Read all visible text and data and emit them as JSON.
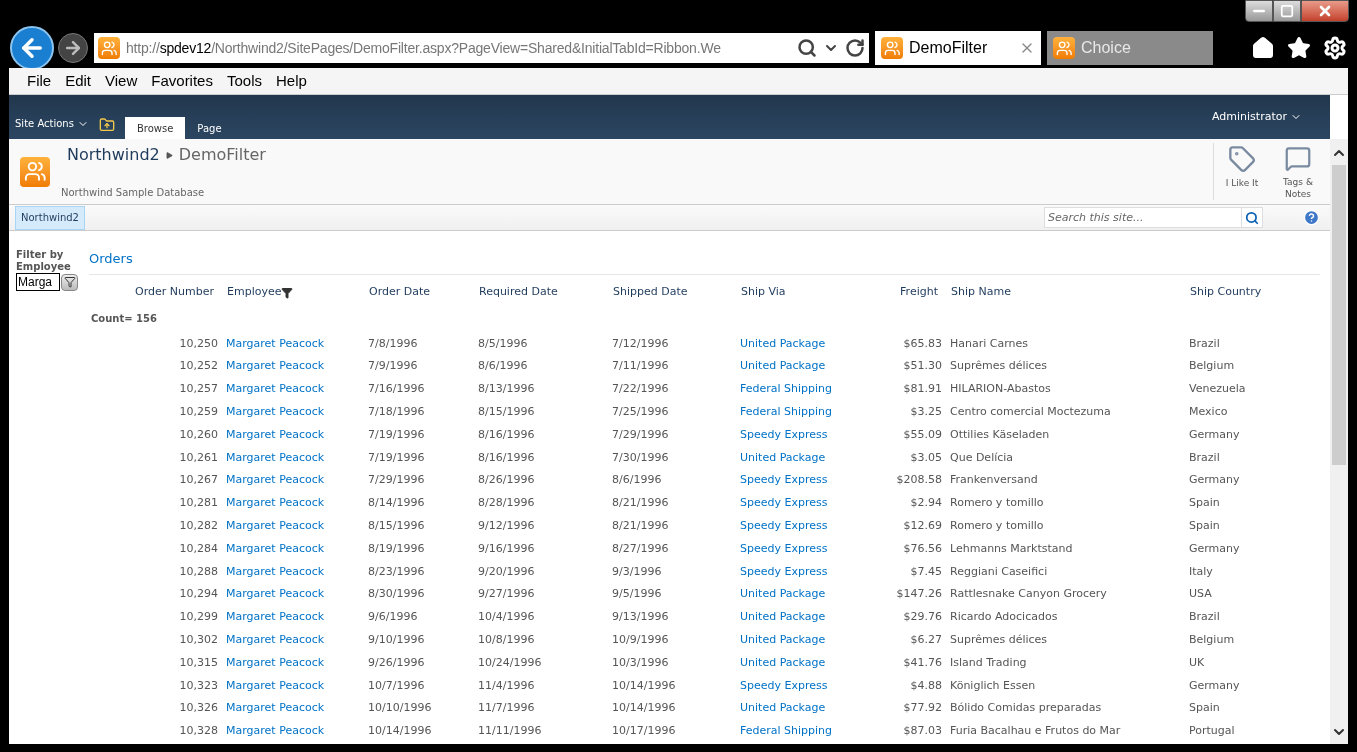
{
  "browser": {
    "url": [
      {
        "text": "http://",
        "emphasis": false
      },
      {
        "text": "spdev12",
        "emphasis": true
      },
      {
        "text": "/Northwind2/SitePages/DemoFilter.aspx?PageView=Shared&InitialTabId=Ribbon.We",
        "emphasis": false
      }
    ],
    "tabs": [
      {
        "title": "DemoFilter",
        "selected": true
      },
      {
        "title": "Choice",
        "selected": false
      }
    ],
    "menu": [
      "File",
      "Edit",
      "View",
      "Favorites",
      "Tools",
      "Help"
    ]
  },
  "ribbon": {
    "site_actions": "Site Actions",
    "tabs": [
      {
        "label": "Browse",
        "selected": true
      },
      {
        "label": "Page",
        "selected": false
      }
    ],
    "user": "Administrator"
  },
  "header": {
    "breadcrumb": [
      "Northwind2",
      "DemoFilter"
    ],
    "description": "Northwind Sample Database",
    "actions": [
      {
        "kind": "like",
        "label": "I Like It"
      },
      {
        "kind": "tags",
        "label": "Tags & Notes"
      }
    ]
  },
  "nav": {
    "items": [
      {
        "label": "Northwind2",
        "selected": true
      }
    ],
    "search_placeholder": "Search this site..."
  },
  "filter": {
    "label": "Filter by Employee",
    "value": "Marga"
  },
  "orders": {
    "title": "Orders",
    "count": "Count= 156",
    "columns": [
      {
        "label": "Order Number",
        "kind": "number",
        "filtered": false
      },
      {
        "label": "Employee",
        "kind": "link",
        "filtered": true
      },
      {
        "label": "Order Date",
        "kind": "text",
        "filtered": false
      },
      {
        "label": "Required Date",
        "kind": "text",
        "filtered": false
      },
      {
        "label": "Shipped Date",
        "kind": "text",
        "filtered": false
      },
      {
        "label": "Ship Via",
        "kind": "link",
        "filtered": false
      },
      {
        "label": "Freight",
        "kind": "number",
        "filtered": false
      },
      {
        "label": "Ship Name",
        "kind": "text",
        "filtered": false
      },
      {
        "label": "Ship Country",
        "kind": "text",
        "filtered": false
      }
    ],
    "rows": [
      [
        "10,250",
        "Margaret Peacock",
        "7/8/1996",
        "8/5/1996",
        "7/12/1996",
        "United Package",
        "$65.83",
        "Hanari Carnes",
        "Brazil"
      ],
      [
        "10,252",
        "Margaret Peacock",
        "7/9/1996",
        "8/6/1996",
        "7/11/1996",
        "United Package",
        "$51.30",
        "Suprêmes délices",
        "Belgium"
      ],
      [
        "10,257",
        "Margaret Peacock",
        "7/16/1996",
        "8/13/1996",
        "7/22/1996",
        "Federal Shipping",
        "$81.91",
        "HILARION-Abastos",
        "Venezuela"
      ],
      [
        "10,259",
        "Margaret Peacock",
        "7/18/1996",
        "8/15/1996",
        "7/25/1996",
        "Federal Shipping",
        "$3.25",
        "Centro comercial Moctezuma",
        "Mexico"
      ],
      [
        "10,260",
        "Margaret Peacock",
        "7/19/1996",
        "8/16/1996",
        "7/29/1996",
        "Speedy Express",
        "$55.09",
        "Ottilies Käseladen",
        "Germany"
      ],
      [
        "10,261",
        "Margaret Peacock",
        "7/19/1996",
        "8/16/1996",
        "7/30/1996",
        "United Package",
        "$3.05",
        "Que Delícia",
        "Brazil"
      ],
      [
        "10,267",
        "Margaret Peacock",
        "7/29/1996",
        "8/26/1996",
        "8/6/1996",
        "Speedy Express",
        "$208.58",
        "Frankenversand",
        "Germany"
      ],
      [
        "10,281",
        "Margaret Peacock",
        "8/14/1996",
        "8/28/1996",
        "8/21/1996",
        "Speedy Express",
        "$2.94",
        "Romero y tomillo",
        "Spain"
      ],
      [
        "10,282",
        "Margaret Peacock",
        "8/15/1996",
        "9/12/1996",
        "8/21/1996",
        "Speedy Express",
        "$12.69",
        "Romero y tomillo",
        "Spain"
      ],
      [
        "10,284",
        "Margaret Peacock",
        "8/19/1996",
        "9/16/1996",
        "8/27/1996",
        "Speedy Express",
        "$76.56",
        "Lehmanns Marktstand",
        "Germany"
      ],
      [
        "10,288",
        "Margaret Peacock",
        "8/23/1996",
        "9/20/1996",
        "9/3/1996",
        "Speedy Express",
        "$7.45",
        "Reggiani Caseifici",
        "Italy"
      ],
      [
        "10,294",
        "Margaret Peacock",
        "8/30/1996",
        "9/27/1996",
        "9/5/1996",
        "United Package",
        "$147.26",
        "Rattlesnake Canyon Grocery",
        "USA"
      ],
      [
        "10,299",
        "Margaret Peacock",
        "9/6/1996",
        "10/4/1996",
        "9/13/1996",
        "United Package",
        "$29.76",
        "Ricardo Adocicados",
        "Brazil"
      ],
      [
        "10,302",
        "Margaret Peacock",
        "9/10/1996",
        "10/8/1996",
        "10/9/1996",
        "United Package",
        "$6.27",
        "Suprêmes délices",
        "Belgium"
      ],
      [
        "10,315",
        "Margaret Peacock",
        "9/26/1996",
        "10/24/1996",
        "10/3/1996",
        "United Package",
        "$41.76",
        "Island Trading",
        "UK"
      ],
      [
        "10,323",
        "Margaret Peacock",
        "10/7/1996",
        "11/4/1996",
        "10/14/1996",
        "Speedy Express",
        "$4.88",
        "Königlich Essen",
        "Germany"
      ],
      [
        "10,326",
        "Margaret Peacock",
        "10/10/1996",
        "11/7/1996",
        "10/14/1996",
        "United Package",
        "$77.92",
        "Bólido Comidas preparadas",
        "Spain"
      ],
      [
        "10,328",
        "Margaret Peacock",
        "10/14/1996",
        "11/11/1996",
        "10/17/1996",
        "Federal Shipping",
        "$87.03",
        "Furia Bacalhau e Frutos do Mar",
        "Portugal"
      ]
    ]
  }
}
